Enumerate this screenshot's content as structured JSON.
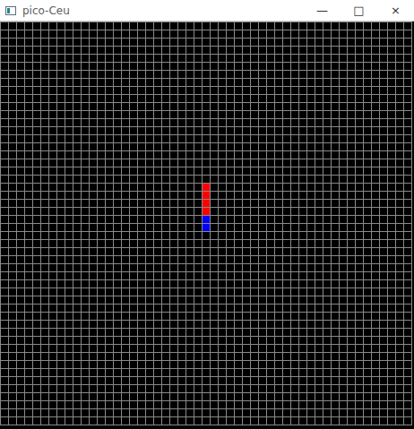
{
  "window": {
    "title": "pico-Ceu",
    "controls": [
      "—",
      "□",
      "×"
    ]
  },
  "board": {
    "cols": 51,
    "rows": 50,
    "snake": [
      {
        "col": 25,
        "row": 20,
        "color": "#ff0000"
      },
      {
        "col": 25,
        "row": 21,
        "color": "#ff0000"
      },
      {
        "col": 25,
        "row": 22,
        "color": "#ff0000"
      },
      {
        "col": 25,
        "row": 23,
        "color": "#ff0000"
      },
      {
        "col": 25,
        "row": 24,
        "color": "#0000ff"
      },
      {
        "col": 25,
        "row": 25,
        "color": "#0000ff"
      }
    ]
  }
}
